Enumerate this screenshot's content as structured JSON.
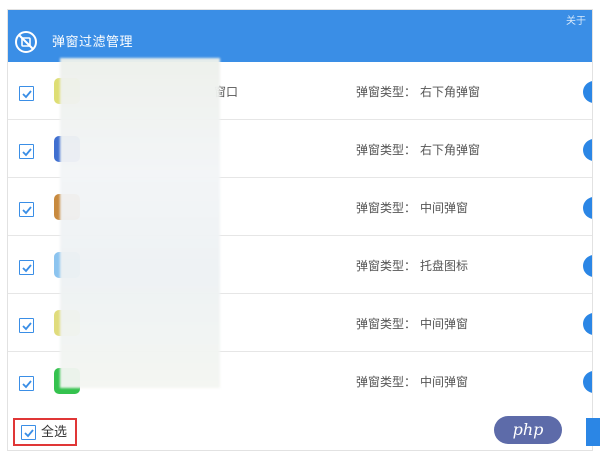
{
  "window": {
    "title": "弹窗过滤管理",
    "title_extra": "关于"
  },
  "rows": [
    {
      "app_name": "窗口",
      "type_label": "弹窗类型：",
      "type_value": "右下角弹窗",
      "icon_color": "#dede74",
      "checked": true
    },
    {
      "app_name": "",
      "type_label": "弹窗类型：",
      "type_value": "右下角弹窗",
      "icon_color": "#3f6fd0",
      "checked": true
    },
    {
      "app_name": "",
      "type_label": "弹窗类型：",
      "type_value": "中间弹窗",
      "icon_color": "#c88a3e",
      "checked": true
    },
    {
      "app_name": "",
      "type_label": "弹窗类型：",
      "type_value": "托盘图标",
      "icon_color": "#8cc4ef",
      "checked": true
    },
    {
      "app_name": "",
      "type_label": "弹窗类型：",
      "type_value": "中间弹窗",
      "icon_color": "#e0dc7c",
      "checked": true
    },
    {
      "app_name": "",
      "type_label": "弹窗类型：",
      "type_value": "中间弹窗",
      "icon_color": "#34c24e",
      "checked": true
    }
  ],
  "footer": {
    "select_all_label": "全选",
    "select_all_checked": true
  },
  "watermark": "php",
  "colors": {
    "accent": "#3a8ee6",
    "toggle": "#2b86e5",
    "highlight": "#e03636"
  }
}
